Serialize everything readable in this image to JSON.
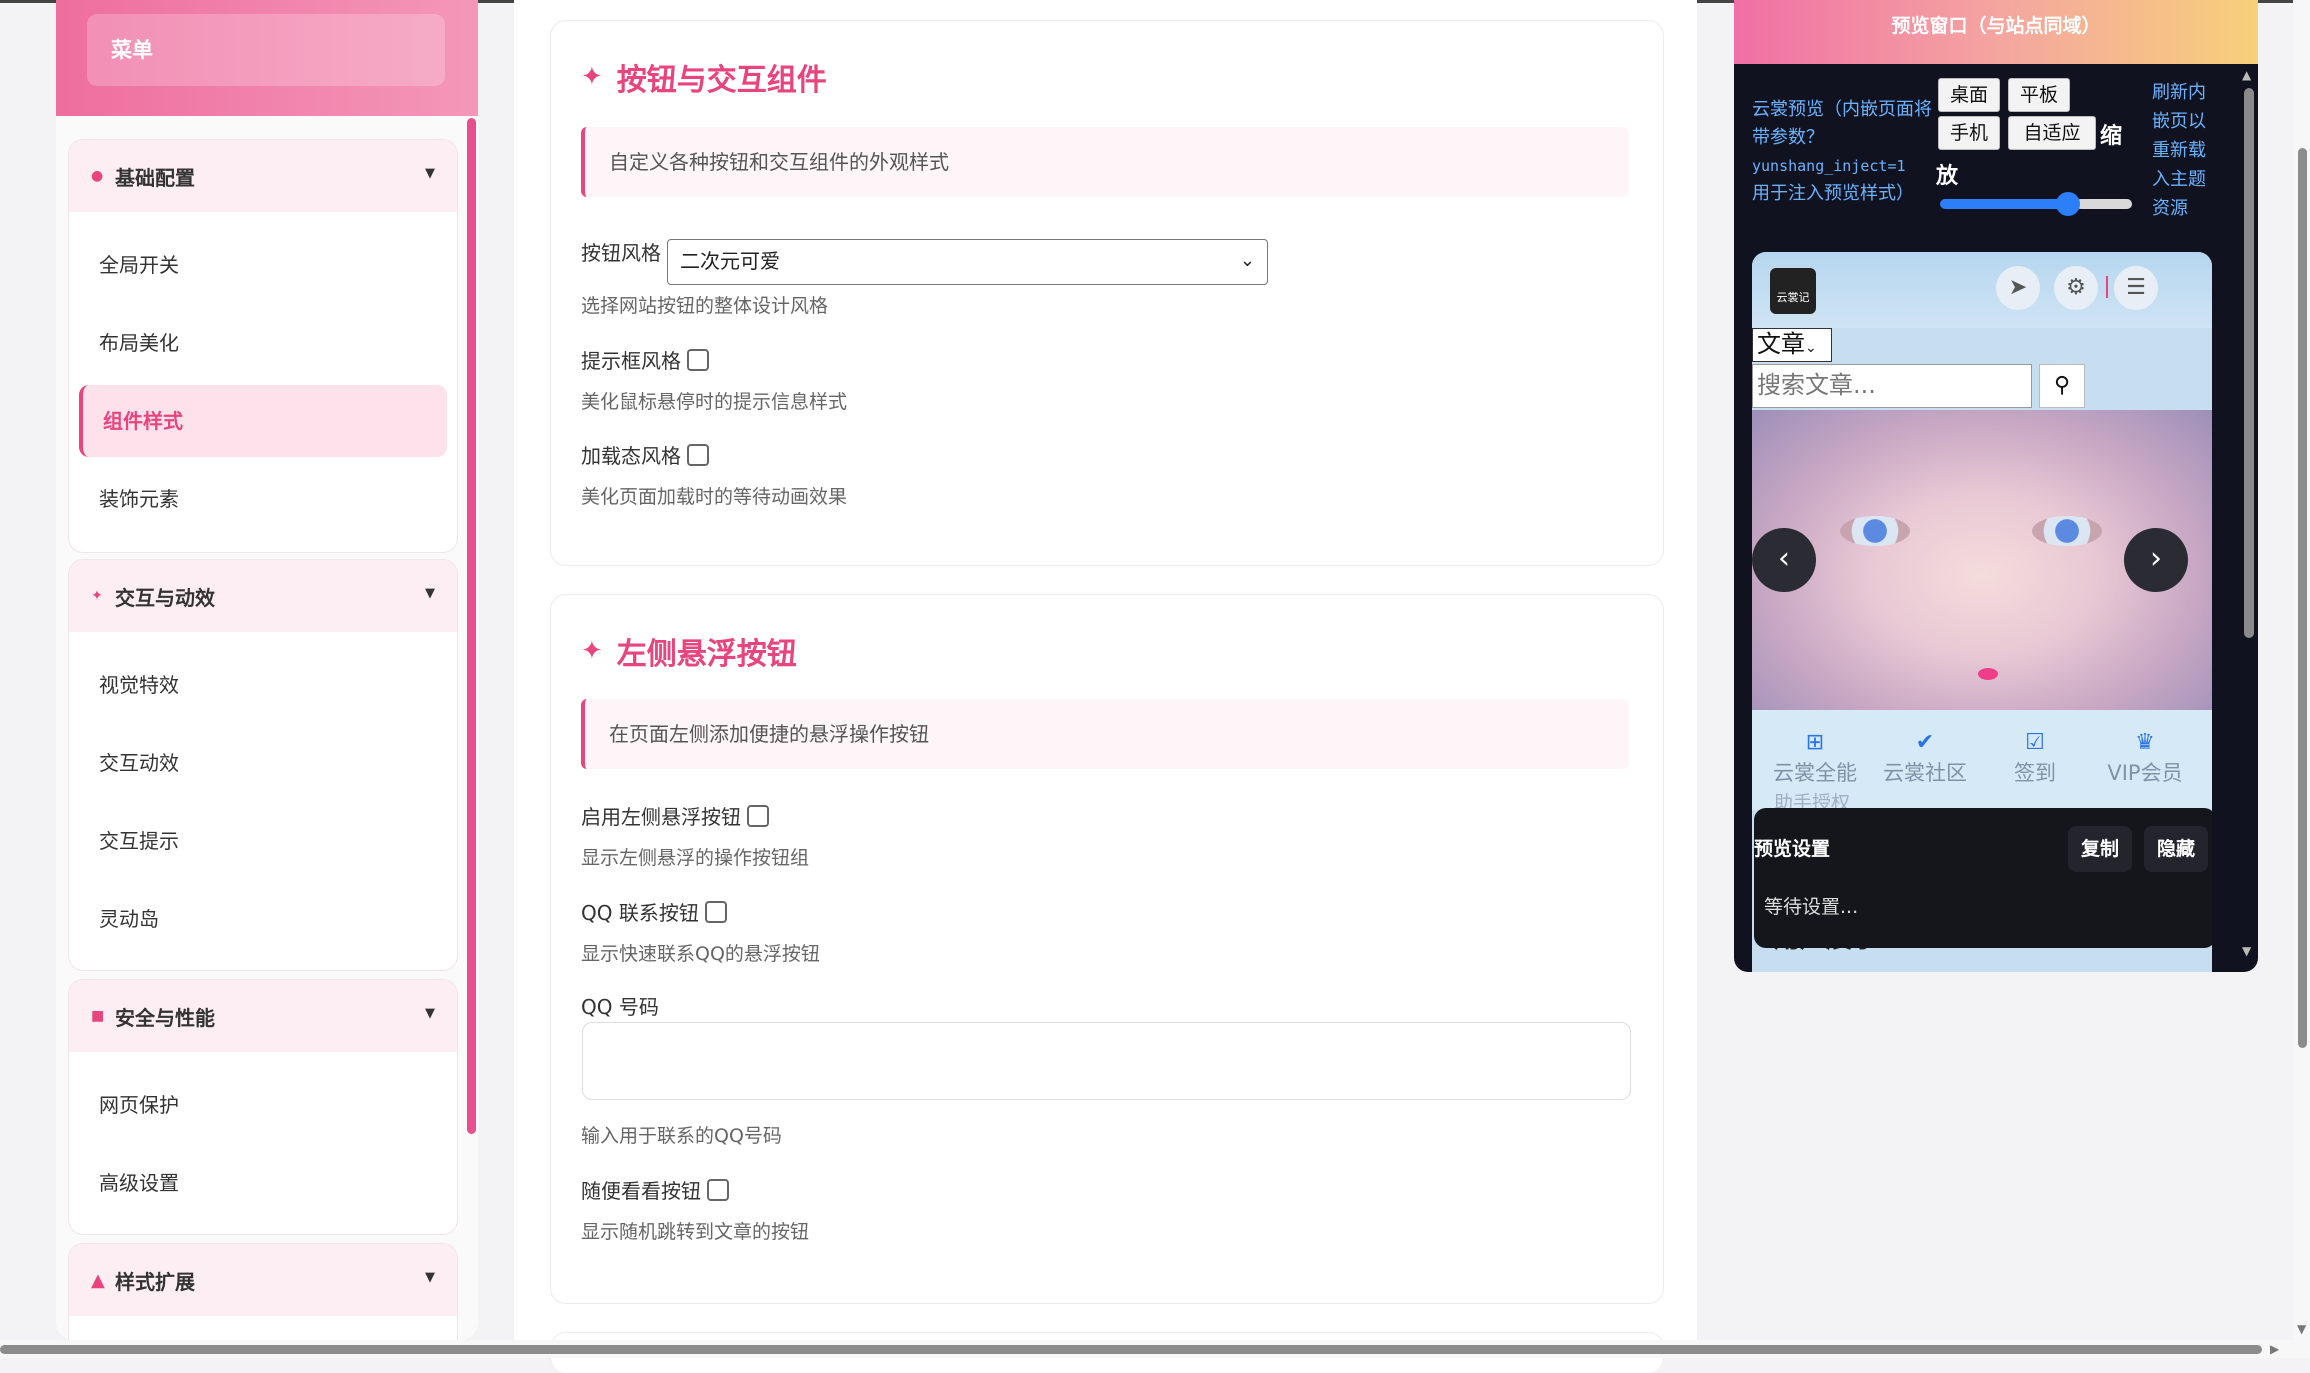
{
  "sidebar": {
    "menu_title": "菜单",
    "groups": [
      {
        "title": "基础配置",
        "icon": "dot-icon",
        "items": [
          "全局开关",
          "布局美化",
          "组件样式",
          "装饰元素"
        ],
        "active": "组件样式"
      },
      {
        "title": "交互与动效",
        "icon": "sparkle-icon",
        "items": [
          "视觉特效",
          "交互动效",
          "交互提示",
          "灵动岛"
        ]
      },
      {
        "title": "安全与性能",
        "icon": "square-icon",
        "items": [
          "网页保护",
          "高级设置"
        ]
      },
      {
        "title": "样式扩展",
        "icon": "triangle-icon",
        "items": []
      }
    ]
  },
  "main": {
    "buttons_card": {
      "title": "按钮与交互组件",
      "desc": "自定义各种按钮和交互组件的外观样式",
      "button_style_label": "按钮风格",
      "button_style_value": "二次元可爱",
      "button_style_help": "选择网站按钮的整体设计风格",
      "tooltip_label": "提示框风格",
      "tooltip_help": "美化鼠标悬停时的提示信息样式",
      "loading_label": "加载态风格",
      "loading_help": "美化页面加载时的等待动画效果"
    },
    "float_card": {
      "title": "左侧悬浮按钮",
      "desc": "在页面左侧添加便捷的悬浮操作按钮",
      "enable_label": "启用左侧悬浮按钮",
      "enable_help": "显示左侧悬浮的操作按钮组",
      "qq_label": "QQ 联系按钮",
      "qq_help": "显示快速联系QQ的悬浮按钮",
      "qq_number_label": "QQ 号码",
      "qq_number_value": "",
      "qq_number_help": "输入用于联系的QQ号码",
      "random_label": "随便看看按钮",
      "random_help": "显示随机跳转到文章的按钮"
    }
  },
  "preview": {
    "bar_title": "预览窗口（与站点同域）",
    "note_line1": "云裳预览（内嵌页面将带参数？",
    "note_param": "yunshang_inject=1",
    "note_line2": "用于注入预览样式）",
    "device_buttons": [
      "桌面",
      "平板",
      "手机",
      "自适应"
    ],
    "zoom_label_1": "缩",
    "zoom_label_2": "放",
    "zoom_value": 0.7,
    "reload_text": "刷新内嵌页以重新载入主题资源",
    "site": {
      "logo_text": "云裳记",
      "category_select": "文章",
      "search_placeholder": "搜索文章...",
      "quick_links": [
        {
          "icon": "grid-icon",
          "label": "云裳全能"
        },
        {
          "icon": "check-circle-icon",
          "label": "云裳社区"
        },
        {
          "icon": "calendar-check-icon",
          "label": "签到"
        },
        {
          "icon": "crown-icon",
          "label": "VIP会员"
        }
      ],
      "partial_text": "助手授权",
      "section_title": "用户展示"
    },
    "settings_popup": {
      "title": "预览设置",
      "copy_label": "复制",
      "hide_label": "隐藏",
      "status": "等待设置..."
    }
  }
}
